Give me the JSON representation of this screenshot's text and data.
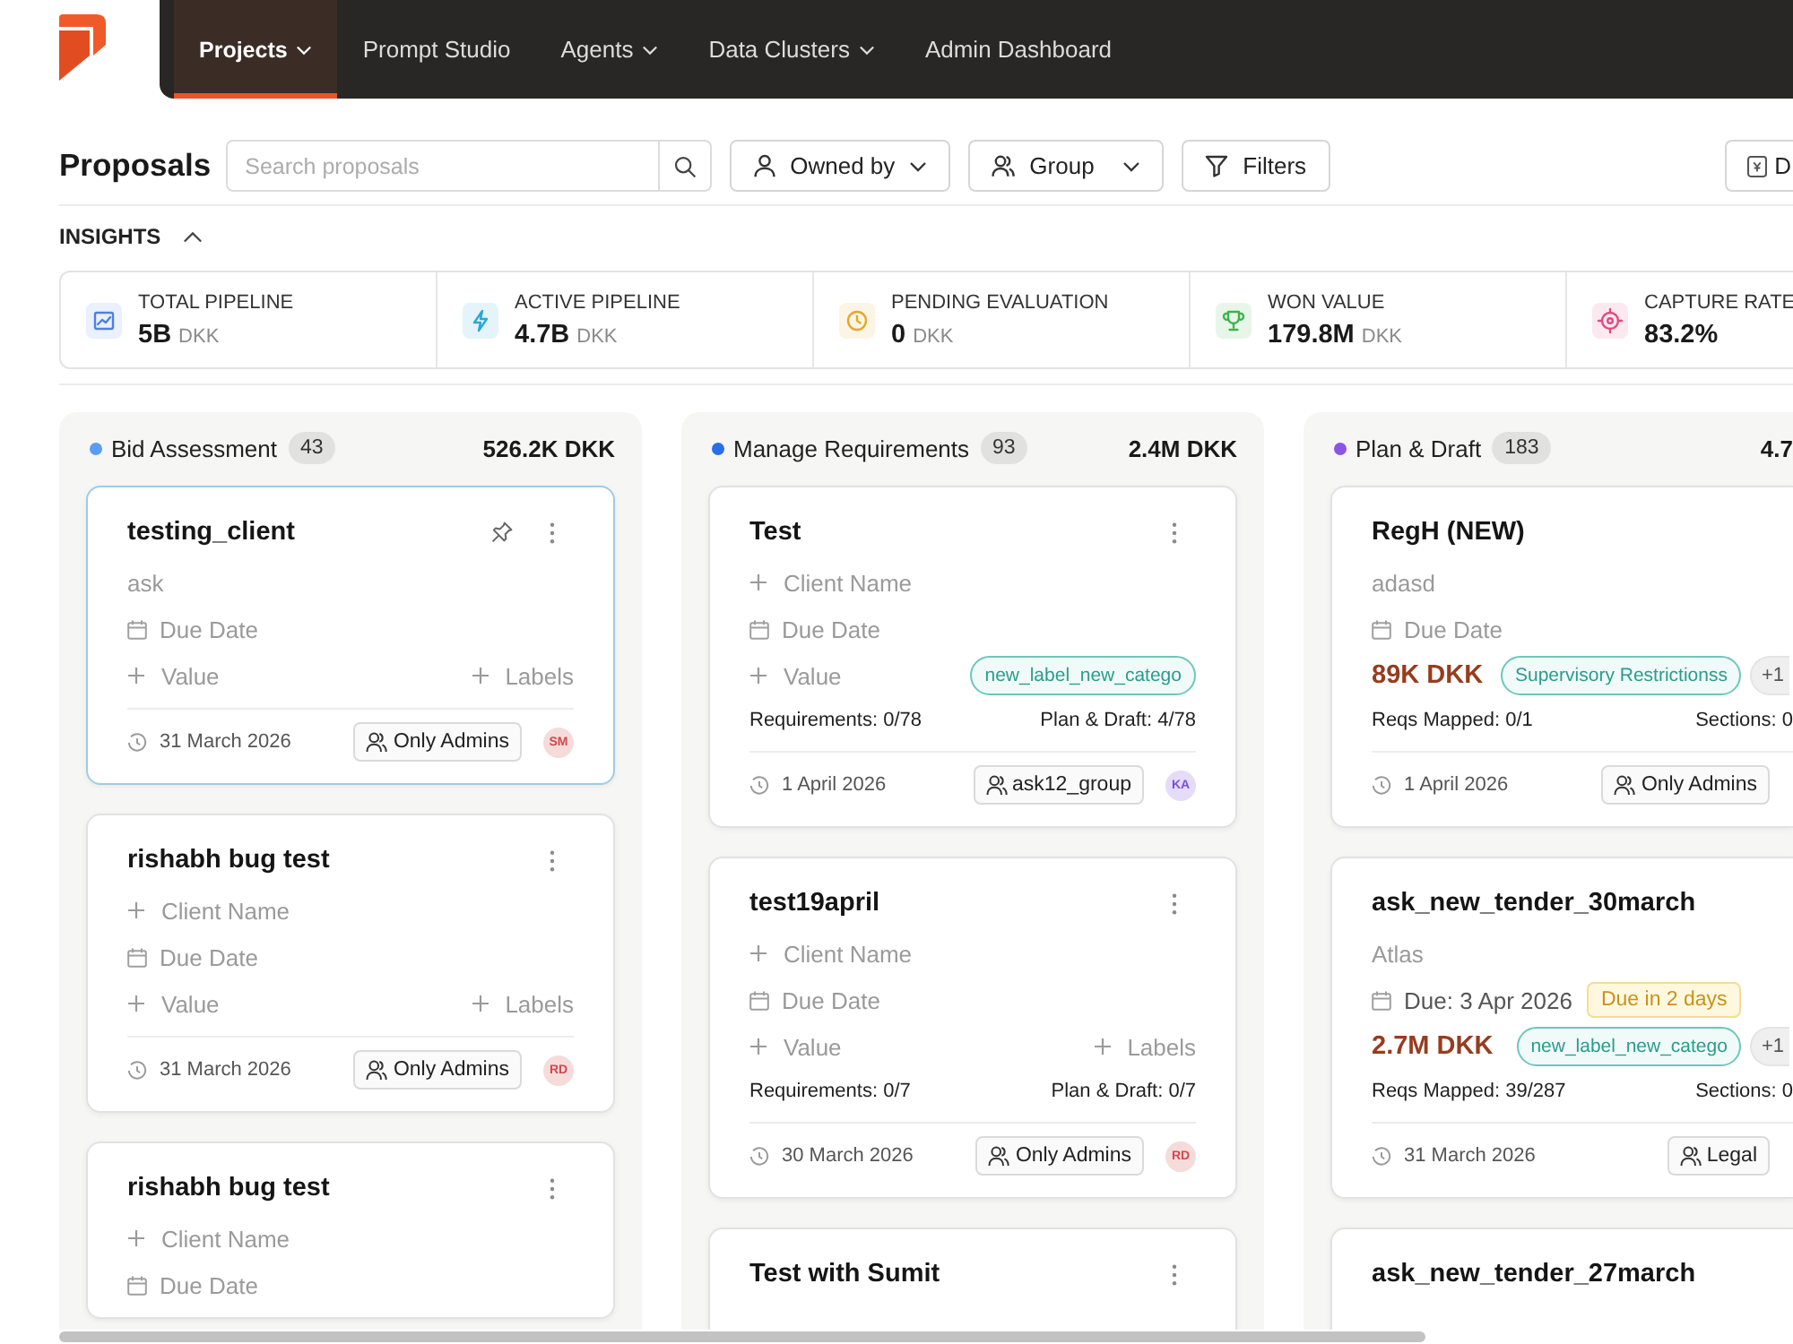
{
  "nav": {
    "items": [
      {
        "label": "Projects",
        "dropdown": true,
        "selected": true
      },
      {
        "label": "Prompt Studio",
        "dropdown": false,
        "selected": false
      },
      {
        "label": "Agents",
        "dropdown": true,
        "selected": false
      },
      {
        "label": "Data Clusters",
        "dropdown": true,
        "selected": false
      },
      {
        "label": "Admin Dashboard",
        "dropdown": false,
        "selected": false
      }
    ]
  },
  "toolbar": {
    "title": "Proposals",
    "search": {
      "placeholder": "Search proposals"
    },
    "filters": [
      {
        "label": "Owned by",
        "kind": "dropdown"
      },
      {
        "label": "Group",
        "kind": "dropdown"
      },
      {
        "label": "Filters",
        "kind": "button"
      }
    ],
    "action": {
      "label": "D"
    }
  },
  "insights": {
    "title": "INSIGHTS",
    "expanded": true,
    "metrics": [
      {
        "label": "TOTAL PIPELINE",
        "value": "5B",
        "unit": "DKK",
        "kind": "chart"
      },
      {
        "label": "ACTIVE PIPELINE",
        "value": "4.7B",
        "unit": "DKK",
        "kind": "bolt"
      },
      {
        "label": "PENDING EVALUATION",
        "value": "0",
        "unit": "DKK",
        "kind": "clock"
      },
      {
        "label": "WON VALUE",
        "value": "179.8M",
        "unit": "DKK",
        "kind": "trophy"
      },
      {
        "label": "CAPTURE RATE",
        "value": "83.2%",
        "kind": "target"
      }
    ]
  },
  "board": {
    "columns": [
      {
        "name": "Bid Assessment",
        "count": "43",
        "total": "526.2K DKK",
        "color": "#5b9cf5",
        "cards": [
          {
            "title": "testing_client",
            "pinned": true,
            "selected": true,
            "client": {
              "kind": "name",
              "text": "ask"
            },
            "due": {
              "kind": "empty",
              "text": "Due Date"
            },
            "value": {
              "kind": "add",
              "text": "Value"
            },
            "labels": [
              {
                "kind": "add",
                "text": "Labels"
              }
            ],
            "footer": {
              "date": "31 March 2026",
              "access": "Only Admins",
              "avatar": {
                "initials": "SM",
                "color": "#d0494a"
              }
            }
          },
          {
            "title": "rishabh bug test",
            "pinned": false,
            "selected": false,
            "client": {
              "kind": "add",
              "text": "Client Name"
            },
            "due": {
              "kind": "empty",
              "text": "Due Date"
            },
            "value": {
              "kind": "add",
              "text": "Value"
            },
            "labels": [
              {
                "kind": "add",
                "text": "Labels"
              }
            ],
            "footer": {
              "date": "31 March 2026",
              "access": "Only Admins",
              "avatar": {
                "initials": "RD",
                "color": "#d0494a"
              }
            }
          },
          {
            "title": "rishabh bug test",
            "pinned": false,
            "selected": false,
            "client": {
              "kind": "add",
              "text": "Client Name"
            },
            "due": {
              "kind": "empty",
              "text": "Due Date"
            }
          }
        ]
      },
      {
        "name": "Manage Requirements",
        "count": "93",
        "total": "2.4M DKK",
        "color": "#2a6de8",
        "cards": [
          {
            "title": "Test",
            "pinned": false,
            "selected": false,
            "client": {
              "kind": "add",
              "text": "Client Name"
            },
            "due": {
              "kind": "empty",
              "text": "Due Date"
            },
            "value": {
              "kind": "add",
              "text": "Value"
            },
            "labels": [
              {
                "kind": "tag",
                "text": "new_label_new_catego"
              }
            ],
            "progress": [
              "Requirements: 0/78",
              "Plan & Draft: 4/78"
            ],
            "footer": {
              "date": "1 April 2026",
              "access": "ask12_group",
              "avatar": {
                "initials": "KA",
                "color": "#7b4ee0"
              }
            }
          },
          {
            "title": "test19april",
            "pinned": false,
            "selected": false,
            "client": {
              "kind": "add",
              "text": "Client Name"
            },
            "due": {
              "kind": "empty",
              "text": "Due Date"
            },
            "value": {
              "kind": "add",
              "text": "Value"
            },
            "labels": [
              {
                "kind": "add",
                "text": "Labels"
              }
            ],
            "progress": [
              "Requirements: 0/7",
              "Plan & Draft: 0/7"
            ],
            "footer": {
              "date": "30 March 2026",
              "access": "Only Admins",
              "avatar": {
                "initials": "RD",
                "color": "#d0494a"
              }
            }
          },
          {
            "title": "Test with Sumit",
            "pinned": false,
            "selected": false
          }
        ]
      },
      {
        "name": "Plan & Draft",
        "count": "183",
        "total": "4.7",
        "color": "#8b55e8",
        "cards": [
          {
            "title": "RegH (NEW)",
            "pinned": false,
            "selected": false,
            "client": {
              "kind": "name",
              "text": "adasd"
            },
            "due": {
              "kind": "empty",
              "text": "Due Date"
            },
            "value": {
              "kind": "amount",
              "text": "89K DKK"
            },
            "labels": [
              {
                "kind": "tag",
                "text": "Supervisory Restrictionss"
              },
              {
                "kind": "more",
                "text": "+1"
              }
            ],
            "progress": [
              "Reqs Mapped: 0/1",
              "Sections: 0"
            ],
            "footer": {
              "date": "1 April 2026",
              "access": "Only Admins"
            }
          },
          {
            "title": "ask_new_tender_30march",
            "pinned": false,
            "selected": false,
            "client": {
              "kind": "name",
              "text": "Atlas"
            },
            "due": {
              "kind": "set",
              "text": "Due: 3 Apr 2026",
              "badge": "Due in 2 days"
            },
            "value": {
              "kind": "amount",
              "text": "2.7M DKK"
            },
            "labels": [
              {
                "kind": "tag",
                "text": "new_label_new_catego"
              },
              {
                "kind": "more",
                "text": "+1"
              }
            ],
            "progress": [
              "Reqs Mapped: 39/287",
              "Sections: 0"
            ],
            "footer": {
              "date": "31 March 2026",
              "access": "Legal"
            }
          },
          {
            "title": "ask_new_tender_27march",
            "pinned": false,
            "selected": false
          }
        ]
      }
    ]
  }
}
